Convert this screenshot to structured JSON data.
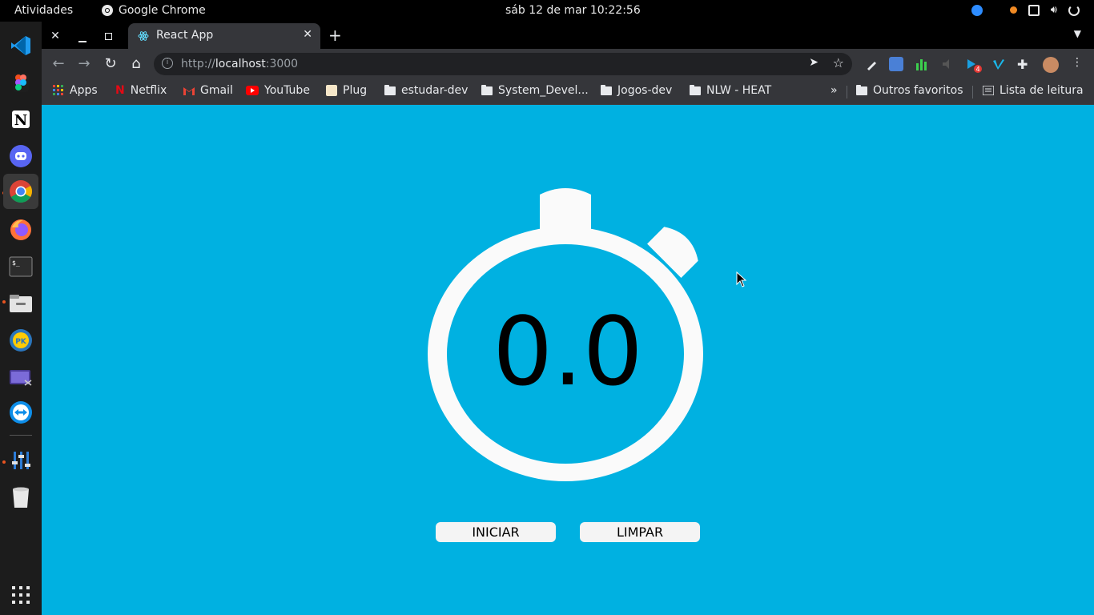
{
  "topbar": {
    "activities": "Atividades",
    "app_name": "Google Chrome",
    "datetime": "sáb 12 de mar  10:22:56"
  },
  "dock": {
    "apps": [
      "vscode-icon",
      "figma-icon",
      "notion-icon",
      "discord-icon",
      "chrome-icon",
      "firefox-icon",
      "terminal-icon",
      "files-icon",
      "pokemon-icon",
      "screenshot-icon",
      "teamviewer-icon",
      "equalizer-icon",
      "trash-icon",
      "app-grid-icon"
    ]
  },
  "browser": {
    "tab_title": "React App",
    "url_prefix": "http://",
    "url_host": "localhost",
    "url_port": ":3000",
    "bookmarks": [
      {
        "label": "Apps",
        "icon": "apps-grid-icon"
      },
      {
        "label": "Netflix",
        "icon": "netflix-icon"
      },
      {
        "label": "Gmail",
        "icon": "gmail-icon"
      },
      {
        "label": "YouTube",
        "icon": "youtube-icon"
      },
      {
        "label": "Plug",
        "icon": "plug-icon"
      },
      {
        "label": "estudar-dev",
        "icon": "folder-icon"
      },
      {
        "label": "System_Devel...",
        "icon": "folder-icon"
      },
      {
        "label": "Jogos-dev",
        "icon": "folder-icon"
      },
      {
        "label": "NLW - HEAT",
        "icon": "folder-icon"
      }
    ],
    "overflow": "»",
    "other_bookmarks": "Outros favoritos",
    "reading_list": "Lista de leitura",
    "extension_badge": "4"
  },
  "app": {
    "timer_value": "0.0",
    "start_label": "INICIAR",
    "clear_label": "LIMPAR"
  },
  "colors": {
    "page_background": "#00b1e1",
    "watch_color": "#fafafa",
    "chrome_toolbar": "#35363a"
  }
}
